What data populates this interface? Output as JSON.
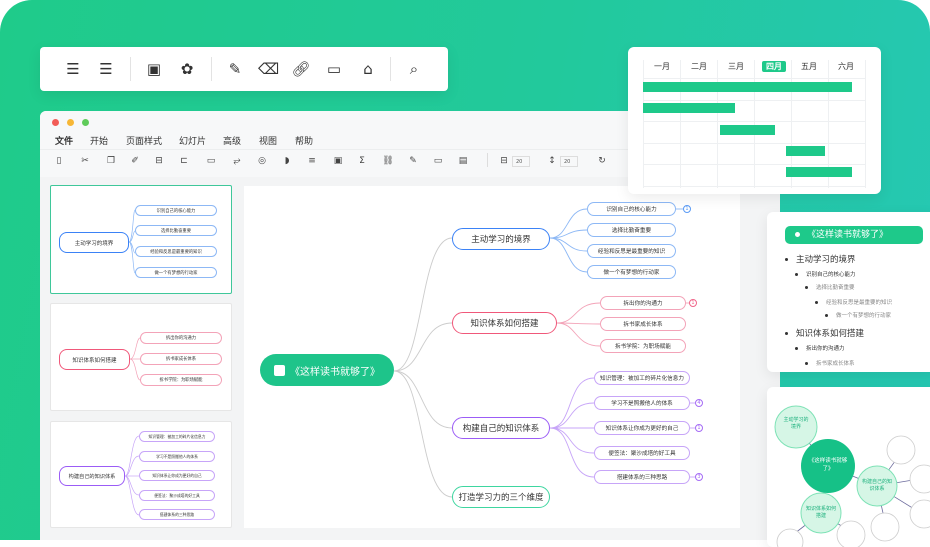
{
  "colors": {
    "brand": "#1ec98a",
    "blue": "#5b9bf5",
    "red": "#f0668a",
    "purple": "#a56cf5",
    "teal": "#3ed6a0"
  },
  "top_toolbar": {
    "icons": [
      "indent-icon",
      "outdent-icon",
      "image-icon",
      "sticker-icon",
      "brush-icon",
      "eraser-icon",
      "link-icon",
      "comment-icon",
      "tag-icon",
      "search-list-icon"
    ]
  },
  "window": {
    "menu": [
      "文件",
      "开始",
      "页面样式",
      "幻灯片",
      "高级",
      "视图",
      "帮助"
    ],
    "toolbar": {
      "spacing_h": "20",
      "spacing_v": "20"
    }
  },
  "mindmap": {
    "root": "《这样读书就够了》",
    "branches": [
      {
        "label": "主动学习的境界",
        "children": [
          "识别自己的核心能力",
          "选择比勤奋重要",
          "经验和反思是最重要的知识",
          "做一个有梦想的行动家"
        ],
        "badges": [
          "1",
          "",
          "",
          ""
        ]
      },
      {
        "label": "知识体系如何搭建",
        "children": [
          "拆出你的沟通力",
          "拆书家成长体系",
          "拆书学院：为职场赋能"
        ],
        "badges": [
          "1",
          "",
          ""
        ]
      },
      {
        "label": "构建自己的知识体系",
        "children": [
          "知识管理：被加工的碎片化信息力",
          "学习不是照搬他人的体系",
          "知识体系让你成为更好的自己",
          "便签法：聚沙成塔的好工具",
          "搭建体系的三种思路"
        ],
        "badges": [
          "",
          "4",
          "1",
          "",
          "3"
        ]
      },
      {
        "label": "打造学习力的三个维度",
        "children": []
      }
    ]
  },
  "gantt": {
    "months": [
      "一月",
      "二月",
      "三月",
      "四月",
      "五月",
      "六月"
    ],
    "selected": "四月",
    "tasks": [
      {
        "start": 0,
        "end": 5.7
      },
      {
        "start": 0,
        "end": 2.5
      },
      {
        "start": 2.1,
        "end": 3.6
      },
      {
        "start": 3.9,
        "end": 4.95
      },
      {
        "start": 3.9,
        "end": 5.7
      }
    ]
  },
  "outline": {
    "title": "《这样读书就够了》",
    "items": [
      {
        "text": "主动学习的境界",
        "level": 0
      },
      {
        "text": "识别自己的核心能力",
        "level": 1
      },
      {
        "text": "选择比勤奋重要",
        "level": 2
      },
      {
        "text": "经验和反思是最重要的知识",
        "level": 3
      },
      {
        "text": "做一个有梦想的行动家",
        "level": 4
      },
      {
        "text": "知识体系如何搭建",
        "level": 0
      },
      {
        "text": "拆出你的沟通力",
        "level": 1
      },
      {
        "text": "拆书家成长体系",
        "level": 2
      }
    ]
  },
  "bubble": {
    "root": "《这样读书就够了》",
    "nodes": [
      "主动学习的境界",
      "构建自己的知识体系",
      "知识体系如何搭建"
    ]
  }
}
